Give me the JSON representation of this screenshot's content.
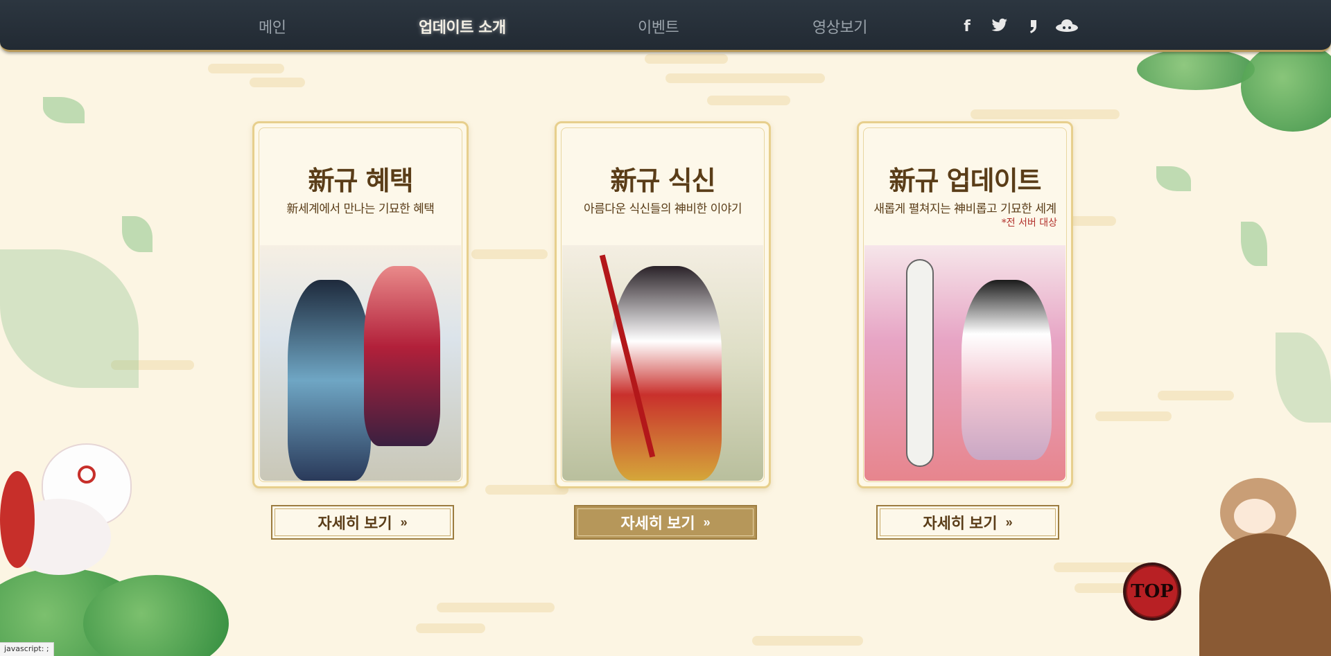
{
  "nav": {
    "items": [
      {
        "label": "메인",
        "active": false
      },
      {
        "label": "업데이트 소개",
        "active": true
      },
      {
        "label": "이벤트",
        "active": false
      },
      {
        "label": "영상보기",
        "active": false
      }
    ],
    "social": [
      "facebook-icon",
      "twitter-icon",
      "naver-cafe-icon",
      "game-community-icon"
    ]
  },
  "cards": [
    {
      "title": "新규 혜택",
      "subtitle": "新세계에서 만나는 기묘한 혜택",
      "note": ""
    },
    {
      "title": "新규 식신",
      "subtitle": "아름다운 식신들의 神비한 이야기",
      "note": ""
    },
    {
      "title": "新규 업데이트",
      "subtitle": "새롭게 펼쳐지는 神비롭고 기묘한 세계",
      "note": "*전 서버 대상"
    }
  ],
  "buttons": {
    "detail_label": "자세히 보기",
    "chevron": "»",
    "active_index": 1
  },
  "top_label": "TOP",
  "status_text": "javascript: ;",
  "colors": {
    "nav_bg": "#27313b",
    "accent_gold": "#b6975a",
    "page_bg": "#fcf5e3",
    "text_brown": "#5a3d18",
    "top_red": "#b82024"
  }
}
